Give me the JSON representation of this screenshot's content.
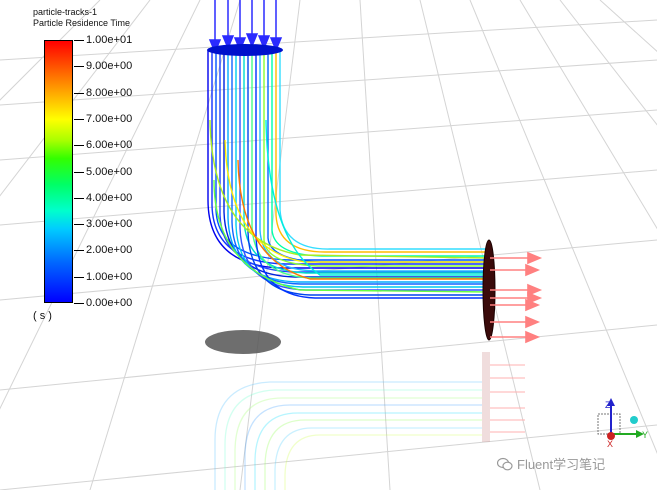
{
  "legend": {
    "title_line1": "particle-tracks-1",
    "title_line2": "Particle Residence Time",
    "unit": "( s )",
    "ticks": [
      "1.00e+01",
      "9.00e+00",
      "8.00e+00",
      "7.00e+00",
      "6.00e+00",
      "5.00e+00",
      "4.00e+00",
      "3.00e+00",
      "2.00e+00",
      "1.00e+00",
      "0.00e+00"
    ],
    "range": [
      0,
      10
    ],
    "colormap": [
      "#0000ff",
      "#00ccff",
      "#00ff66",
      "#ffff00",
      "#ff0000"
    ]
  },
  "axes": {
    "z": "Z",
    "y": "Y",
    "x": "X"
  },
  "watermark": {
    "text": "Fluent学习笔记",
    "icon": "wechat-icon"
  },
  "colors": {
    "floor_grid": "#d4d4d4",
    "inlet_arrows": "#2a2aff",
    "outlet_arrows": "#ff8080",
    "pipe_outlet": "#3a0a0a"
  }
}
